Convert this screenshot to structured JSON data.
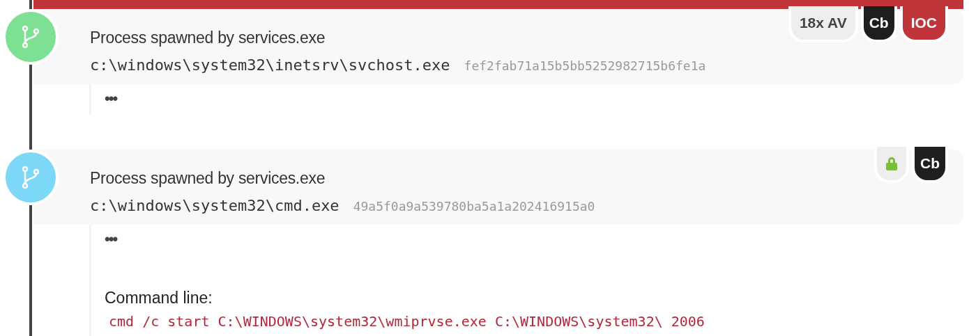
{
  "events": [
    {
      "color": "#7ee092",
      "title": "Process spawned by services.exe",
      "path": "c:\\windows\\system32\\inetsrv\\svchost.exe",
      "hash": "fef2fab71a15b5bb5252982715b6fe1a",
      "alert": true,
      "badges": [
        {
          "kind": "av",
          "text": "18x AV"
        },
        {
          "kind": "cb",
          "text": "Cb"
        },
        {
          "kind": "ioc",
          "text": "IOC"
        }
      ],
      "more": "•••"
    },
    {
      "color": "#7dd8f8",
      "title": "Process spawned by services.exe",
      "path": "c:\\windows\\system32\\cmd.exe",
      "hash": "49a5f0a9a539780ba5a1a202416915a0",
      "alert": false,
      "badges": [
        {
          "kind": "lock"
        },
        {
          "kind": "cb",
          "text": "Cb"
        }
      ],
      "more": "•••",
      "command_label": "Command line:",
      "command": "cmd /c start C:\\WINDOWS\\system32\\wmiprvse.exe C:\\WINDOWS\\system32\\ 2006"
    }
  ]
}
